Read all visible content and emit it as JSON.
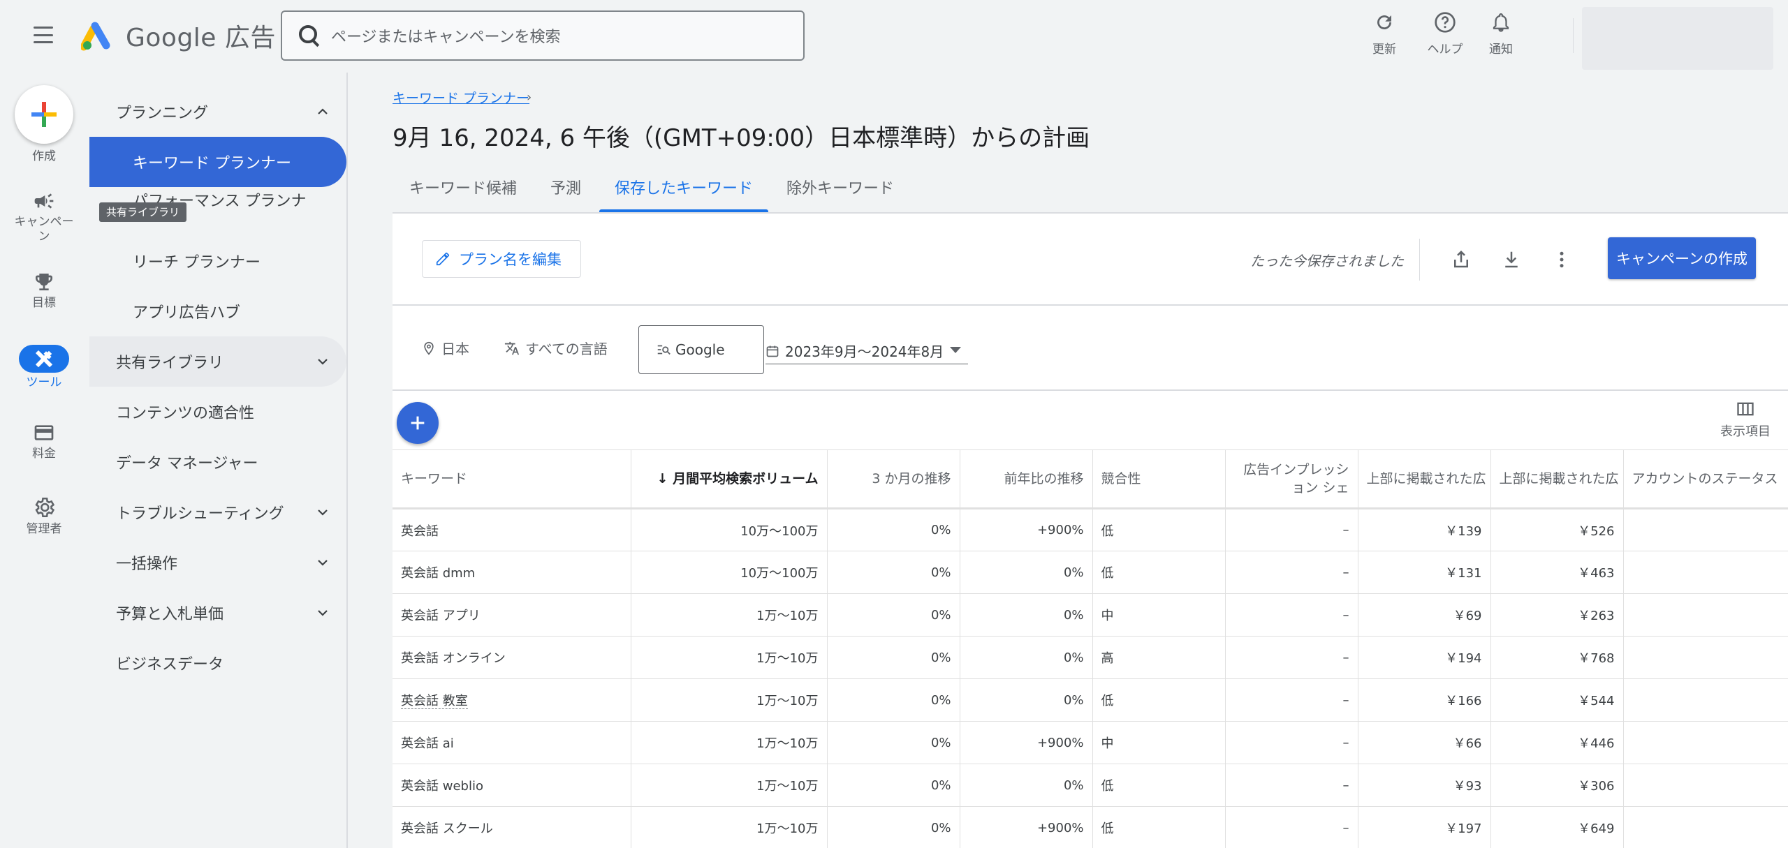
{
  "app": {
    "logo_text": "Google 広告"
  },
  "search": {
    "placeholder": "ページまたはキャンペーンを検索"
  },
  "top_actions": {
    "refresh": "更新",
    "help": "ヘルプ",
    "notifications": "通知"
  },
  "rail": {
    "create": "作成",
    "campaigns": "キャンペーン",
    "goals": "目標",
    "tools": "ツール",
    "billing": "料金",
    "admin": "管理者"
  },
  "nav": {
    "planning": "プランニング",
    "keyword_planner": "キーワード プランナー",
    "performance_planner": "パフォーマンス プランナ",
    "reach_planner": "リーチ プランナー",
    "app_hub": "アプリ広告ハブ",
    "shared_library": "共有ライブラリ",
    "content_suitability": "コンテンツの適合性",
    "data_manager": "データ マネージャー",
    "troubleshooting": "トラブルシューティング",
    "bulk_actions": "一括操作",
    "budgets_bids": "予算と入札単価",
    "business_data": "ビジネスデータ",
    "tooltip": "共有ライブラリ"
  },
  "main": {
    "breadcrumb": "キーワード プランナー",
    "title": "9月 16, 2024, 6 午後（(GMT+09:00）日本標準時）からの計画",
    "tabs": [
      "キーワード候補",
      "予測",
      "保存したキーワード",
      "除外キーワード"
    ],
    "edit_plan": "プラン名を編集",
    "saved_status": "たった今保存されました",
    "create_campaign": "キャンペーンの作成",
    "columns_label": "表示項目"
  },
  "filters": {
    "location": "日本",
    "language": "すべての言語",
    "network": "Google",
    "date_range": "2023年9月〜2024年8月"
  },
  "table": {
    "headers": {
      "keyword": "キーワード",
      "volume": "月間平均検索ボリューム",
      "trend3m": "3 か月の推移",
      "yoy": "前年比の推移",
      "competition": "競合性",
      "impression_share": "広告インプレッション シェ",
      "top_bid_low": "上部に掲載された広",
      "top_bid_high": "上部に掲載された広",
      "account_status": "アカウントのステータス"
    },
    "rows": [
      {
        "keyword": "英会話",
        "volume": "10万〜100万",
        "trend3m": "0%",
        "yoy": "+900%",
        "competition": "低",
        "impression_share": "–",
        "low": "￥139",
        "high": "￥526"
      },
      {
        "keyword": "英会話 dmm",
        "volume": "10万〜100万",
        "trend3m": "0%",
        "yoy": "0%",
        "competition": "低",
        "impression_share": "–",
        "low": "￥131",
        "high": "￥463"
      },
      {
        "keyword": "英会話 アプリ",
        "volume": "1万〜10万",
        "trend3m": "0%",
        "yoy": "0%",
        "competition": "中",
        "impression_share": "–",
        "low": "￥69",
        "high": "￥263"
      },
      {
        "keyword": "英会話 オンライン",
        "volume": "1万〜10万",
        "trend3m": "0%",
        "yoy": "0%",
        "competition": "高",
        "impression_share": "–",
        "low": "￥194",
        "high": "￥768"
      },
      {
        "keyword": "英会話 教室",
        "volume": "1万〜10万",
        "trend3m": "0%",
        "yoy": "0%",
        "competition": "低",
        "impression_share": "–",
        "low": "￥166",
        "high": "￥544"
      },
      {
        "keyword": "英会話 ai",
        "volume": "1万〜10万",
        "trend3m": "0%",
        "yoy": "+900%",
        "competition": "中",
        "impression_share": "–",
        "low": "￥66",
        "high": "￥446"
      },
      {
        "keyword": "英会話 weblio",
        "volume": "1万〜10万",
        "trend3m": "0%",
        "yoy": "0%",
        "competition": "低",
        "impression_share": "–",
        "low": "￥93",
        "high": "￥306"
      },
      {
        "keyword": "英会話 スクール",
        "volume": "1万〜10万",
        "trend3m": "0%",
        "yoy": "+900%",
        "competition": "低",
        "impression_share": "–",
        "low": "￥197",
        "high": "￥649"
      }
    ]
  },
  "colors": {
    "accent": "#1a73e8",
    "active_nav": "#3367d6",
    "background": "#f1f3f4"
  }
}
